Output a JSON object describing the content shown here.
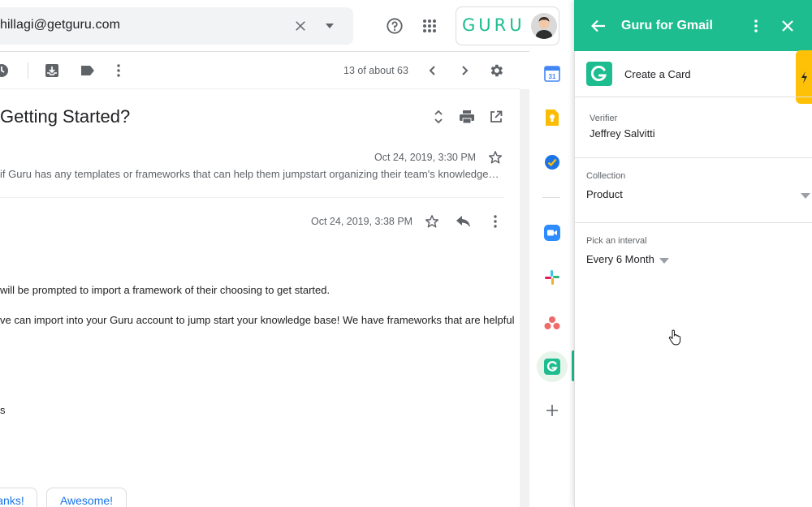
{
  "search": {
    "value": "hillagi@getguru.com"
  },
  "header": {
    "brand_text": "GURU"
  },
  "toolbar": {
    "pager": "13 of about 63"
  },
  "email": {
    "subject": "Getting Started?",
    "messages": [
      {
        "date": "Oct 24, 2019, 3:30 PM",
        "snippet": "if Guru has any templates or frameworks that can help them jumpstart organizing their team's knowledge base..."
      },
      {
        "date": "Oct 24, 2019, 3:38 PM",
        "lines": [
          "will be prompted to import a framework of their choosing to get started.",
          "ve can import into your Guru account to jump start your knowledge base! We have frameworks that are helpful",
          "s"
        ]
      }
    ],
    "smart_replies": [
      "anks!",
      "Awesome!"
    ]
  },
  "rail": {
    "items": [
      "calendar-icon",
      "keep-icon",
      "tasks-icon",
      "zoom-icon",
      "slack-icon",
      "asana-icon",
      "guru-icon",
      "add-icon"
    ]
  },
  "panel": {
    "title": "Guru for Gmail",
    "create_card": "Create a Card",
    "verifier_label": "Verifier",
    "verifier_value": "Jeffrey Salvitti",
    "collection_label": "Collection",
    "collection_value": "Product",
    "interval_label": "Pick an interval",
    "interval_value": "Every 6 Month"
  },
  "colors": {
    "guru_green": "#1ebd8f",
    "accent_yellow": "#ffc107",
    "link_blue": "#1a73e8"
  }
}
